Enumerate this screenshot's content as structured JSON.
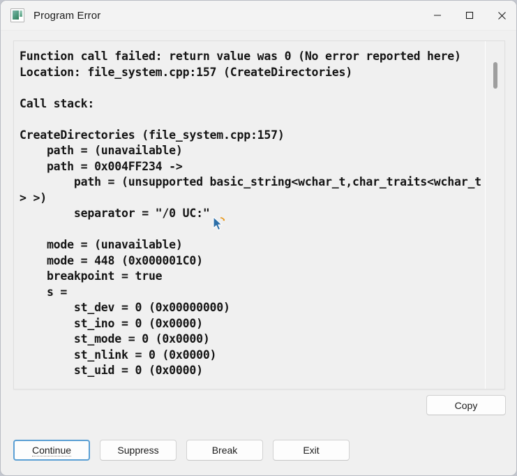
{
  "window": {
    "title": "Program Error",
    "icon": "program-window-icon",
    "controls": {
      "minimize": "minimize-icon",
      "maximize": "maximize-icon",
      "close": "close-icon"
    }
  },
  "error_output": {
    "text": "Function call failed: return value was 0 (No error reported here)\nLocation: file_system.cpp:157 (CreateDirectories)\n\nCall stack:\n\nCreateDirectories (file_system.cpp:157)\n    path = (unavailable)\n    path = 0x004FF234 ->\n        path = (unsupported basic_string<wchar_t,char_traits<wchar_t> >)\n        separator = \"/0 UC:\"\n\n    mode = (unavailable)\n    mode = 448 (0x000001C0)\n    breakpoint = true\n    s =\n        st_dev = 0 (0x00000000)\n        st_ino = 0 (0x0000)\n        st_mode = 0 (0x0000)\n        st_nlink = 0 (0x0000)\n        st_uid = 0 (0x0000)",
    "lines": [
      "Function call failed: return value was 0 (No error reported here)",
      "Location: file_system.cpp:157 (CreateDirectories)",
      "",
      "Call stack:",
      "",
      "CreateDirectories (file_system.cpp:157)",
      "    path = (unavailable)",
      "    path = 0x004FF234 ->",
      "        path = (unsupported basic_string<wchar_t,char_traits<wchar_t> >)",
      "        separator = \"/0 UC:\"",
      "",
      "    mode = (unavailable)",
      "    mode = 448 (0x000001C0)",
      "    breakpoint = true",
      "    s =",
      "        st_dev = 0 (0x00000000)",
      "        st_ino = 0 (0x0000)",
      "        st_mode = 0 (0x0000)",
      "        st_nlink = 0 (0x0000)",
      "        st_uid = 0 (0x0000)"
    ]
  },
  "scrollbar": {
    "name": "vertical-scrollbar",
    "thumb_position_percent": 6
  },
  "copy": {
    "label": "Copy"
  },
  "actions": [
    {
      "label": "Continue",
      "default": true
    },
    {
      "label": "Suppress",
      "default": false
    },
    {
      "label": "Break",
      "default": false
    },
    {
      "label": "Exit",
      "default": false
    }
  ],
  "colors": {
    "window_background": "#f0f0f0",
    "titlebar_background": "#f3f3f3",
    "text": "#141414",
    "focus_border": "#5a9fd4",
    "scroll_thumb": "#9e9e9e"
  }
}
